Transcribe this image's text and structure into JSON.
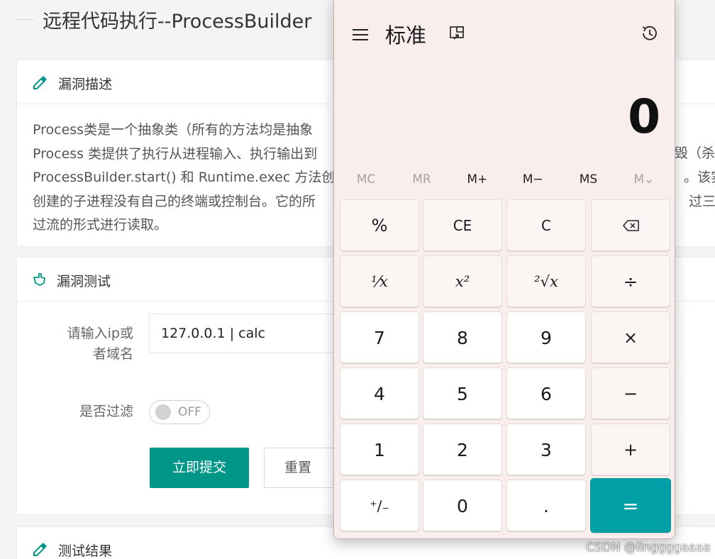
{
  "page": {
    "title": "远程代码执行--ProcessBuilder",
    "description_card": {
      "heading": "漏洞描述",
      "lines": [
        "Process类是一个抽象类（所有的方法均是抽象",
        "Process 类提供了执行从进程输入、执行输出到",
        "ProcessBuilder.start() 和 Runtime.exec 方法创",
        "创建的子进程没有自己的终端或控制台。它的所",
        "过流的形式进行读取。"
      ],
      "right_fragments": [
        "毁（杀",
        "。该实例",
        "过三个"
      ]
    },
    "test_card": {
      "heading": "漏洞测试",
      "ip_label_line1": "请输入ip或",
      "ip_label_line2": "者域名",
      "ip_value": "127.0.0.1 | calc",
      "filter_label": "是否过滤",
      "filter_toggle": "OFF",
      "submit_label": "立即提交",
      "reset_label": "重置"
    },
    "result_card": {
      "heading": "测试结果"
    },
    "accent_color": "#009688"
  },
  "calculator": {
    "mode": "标准",
    "display_value": "0",
    "memory_buttons": [
      {
        "label": "MC",
        "enabled": false
      },
      {
        "label": "MR",
        "enabled": false
      },
      {
        "label": "M+",
        "enabled": true
      },
      {
        "label": "M−",
        "enabled": true
      },
      {
        "label": "MS",
        "enabled": true
      },
      {
        "label": "M⌄",
        "enabled": false
      }
    ],
    "keys": {
      "percent": "%",
      "ce": "CE",
      "clear": "C",
      "backspace_icon": "backspace-icon",
      "reciprocal": "⅟x",
      "square": "x²",
      "sqrt": "²√x",
      "divide": "÷",
      "n7": "7",
      "n8": "8",
      "n9": "9",
      "multiply": "×",
      "n4": "4",
      "n5": "5",
      "n6": "6",
      "minus": "−",
      "n1": "1",
      "n2": "2",
      "n3": "3",
      "plus": "+",
      "negate": "⁺∕₋",
      "n0": "0",
      "decimal": ".",
      "equals": "="
    },
    "equals_color": "#00a0a6"
  },
  "watermark": "CSDN @linggggaaaa"
}
